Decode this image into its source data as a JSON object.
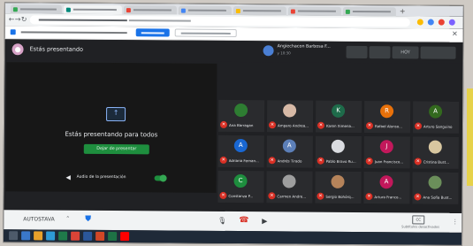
{
  "meet": {
    "presenting_label": "Estás presentando",
    "pinned_name": "Angiechacon Barbosa F...",
    "pinned_sub": "y 10:30",
    "top_controls": [
      "",
      "",
      "HOY",
      ""
    ],
    "presentation": {
      "title": "Estás presentando para todos",
      "stop_button": "Dejar de presentar",
      "audio_label": "Audio de la presentación"
    },
    "participants": [
      {
        "initial": "",
        "name": "Ana Barragan",
        "color": "#2e7d32"
      },
      {
        "initial": "",
        "name": "Amparo Andrea...",
        "color": "#d7b9a6"
      },
      {
        "initial": "K",
        "name": "Karen Ximena...",
        "color": "#1e6b4a"
      },
      {
        "initial": "R",
        "name": "Rafael Alonso...",
        "color": "#e8710a"
      },
      {
        "initial": "A",
        "name": "Arturo Sanguino",
        "color": "#33691e"
      },
      {
        "initial": "A",
        "name": "Adriana Fernan...",
        "color": "#1967d2"
      },
      {
        "initial": "A",
        "name": "Andrés Tirado",
        "color": "#5c7fb8"
      },
      {
        "initial": "",
        "name": "Pablo Bravo Ru...",
        "color": "#dadce0"
      },
      {
        "initial": "J",
        "name": "Juan Francisco...",
        "color": "#c2185b"
      },
      {
        "initial": "",
        "name": "Cristina Bust...",
        "color": "#d8c7a0"
      },
      {
        "initial": "C",
        "name": "Constanza P...",
        "color": "#1e8e3e"
      },
      {
        "initial": "",
        "name": "Carmen Andre...",
        "color": "#9e9e9e"
      },
      {
        "initial": "",
        "name": "Sergio Bohórq...",
        "color": "#b5835a"
      },
      {
        "initial": "A",
        "name": "Arturo Franco...",
        "color": "#c2185b"
      },
      {
        "initial": "",
        "name": "Ana Sofía Bust...",
        "color": "#6b8e5a"
      }
    ],
    "bottom": {
      "autosave_label": "AUTOSTAVA",
      "captions_label": "Subtítulos desactivados"
    }
  },
  "colors": {
    "meet_bg": "#202124",
    "accent_green": "#1e8e3e",
    "mic_off_red": "#d93025",
    "chrome_blue": "#1a73e8"
  }
}
